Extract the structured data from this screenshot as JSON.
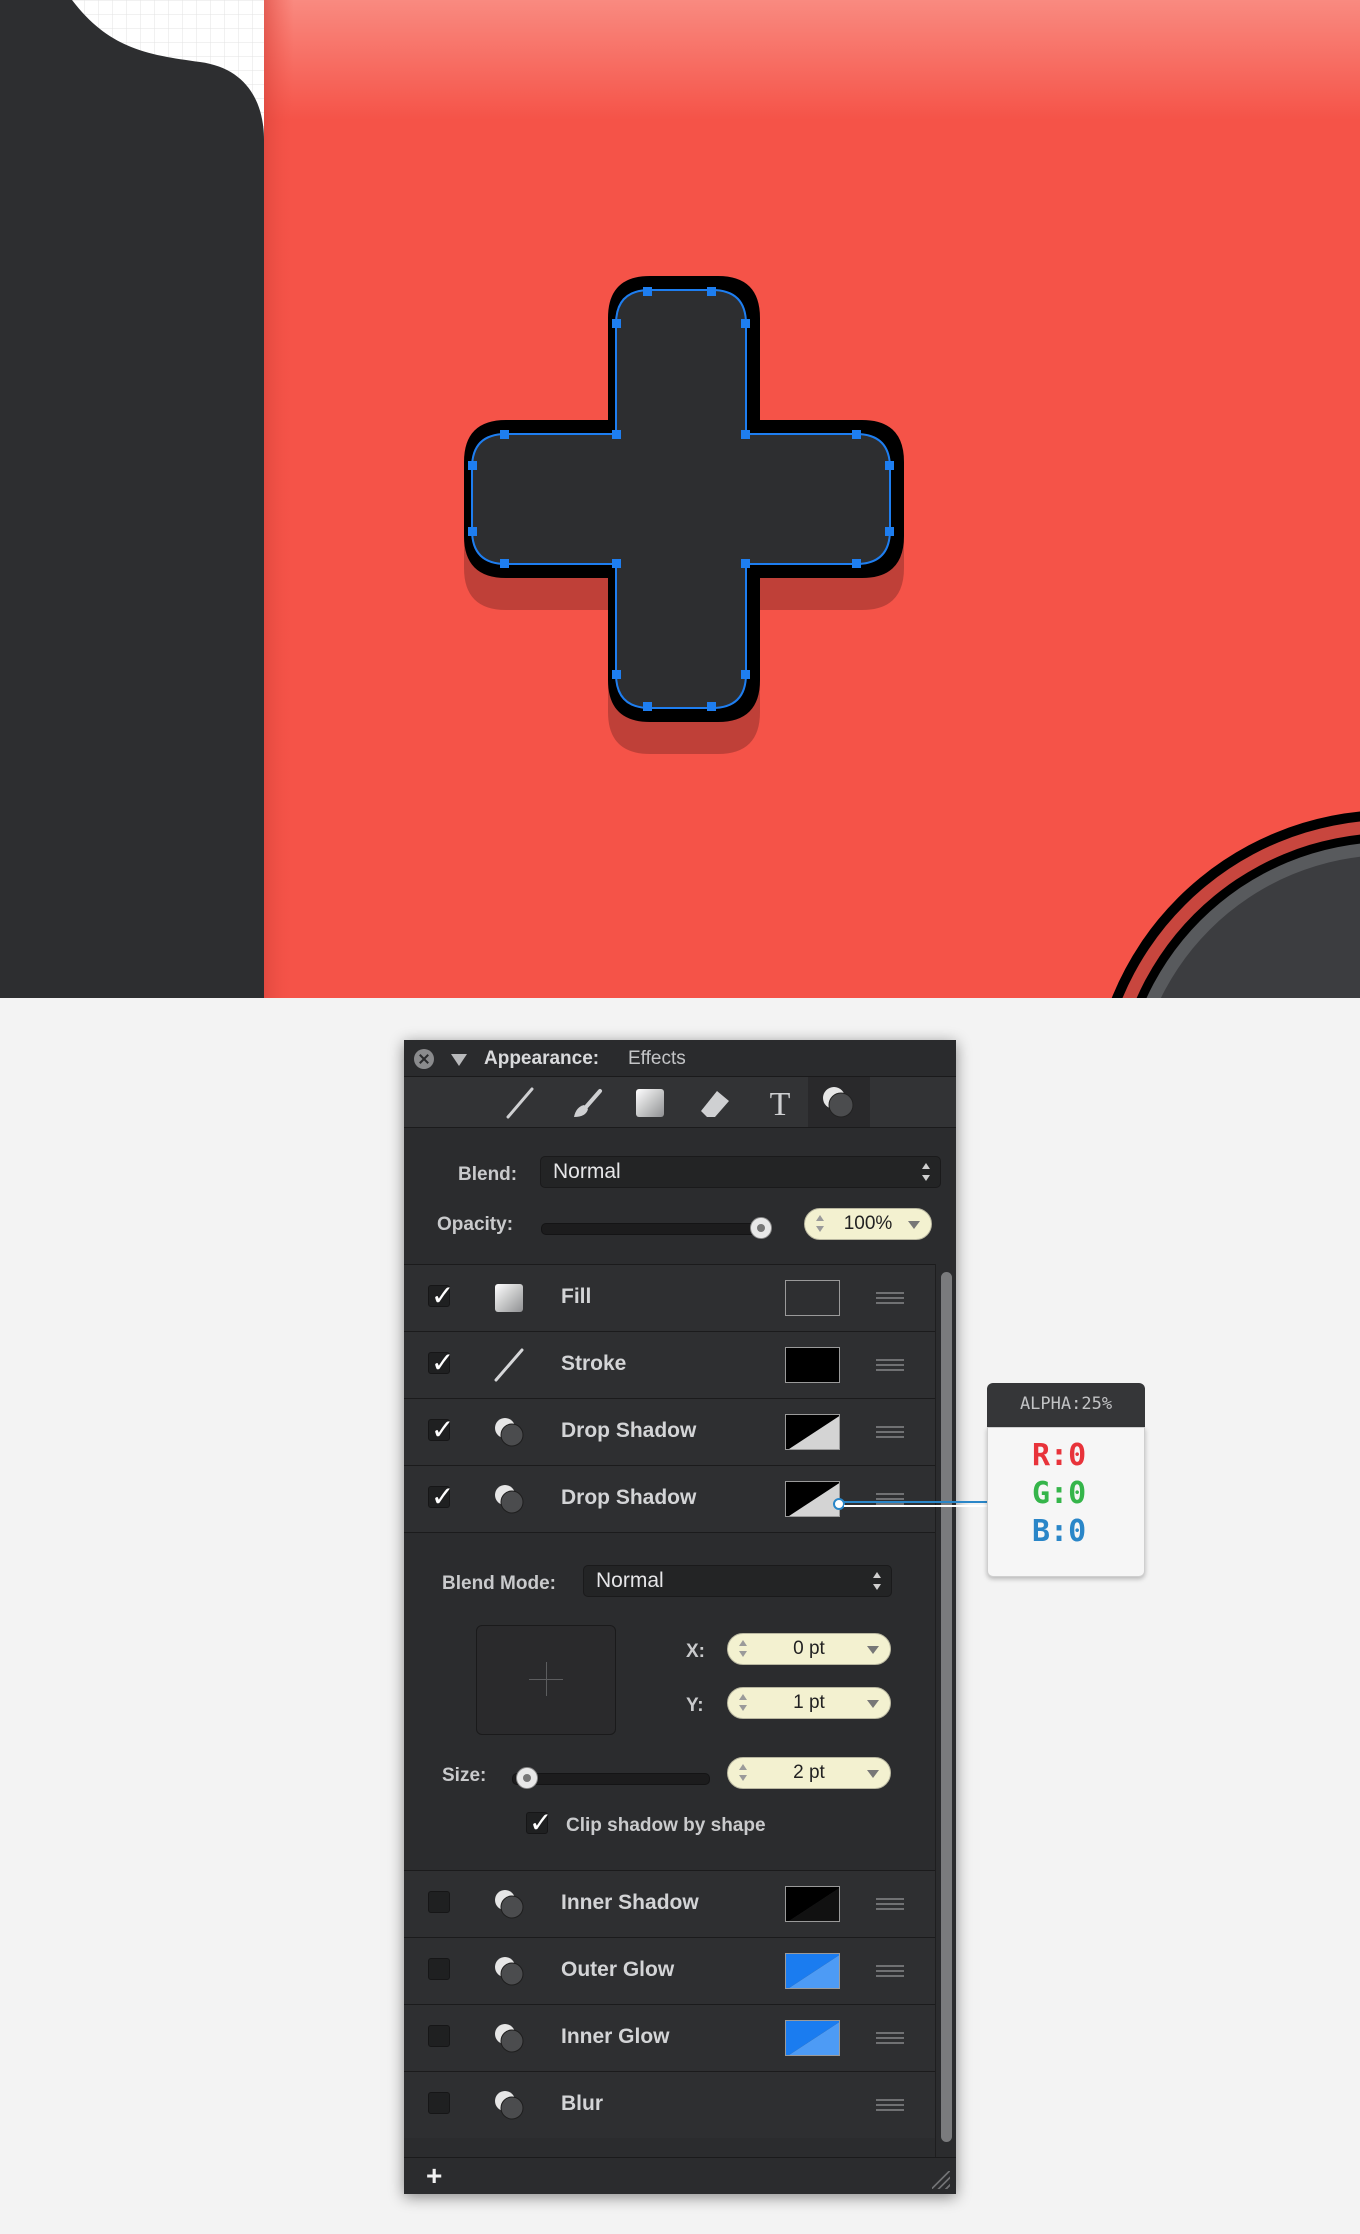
{
  "panel": {
    "title": "Appearance:",
    "subtitle": "Effects",
    "tools": [
      "stroke-tool",
      "brush-tool",
      "fill-tool",
      "eraser-tool",
      "text-tool",
      "effects-tool"
    ],
    "tool_text_glyph": "T",
    "blend_label": "Blend:",
    "blend_value": "Normal",
    "opacity_label": "Opacity:",
    "opacity_value": "100%",
    "opacity_fraction": 1.0,
    "effects": [
      {
        "name": "Fill",
        "enabled": true,
        "icon": "fill-square-icon",
        "swatch": "#2e2f31"
      },
      {
        "name": "Stroke",
        "enabled": true,
        "icon": "stroke-line-icon",
        "swatch": "#000000"
      },
      {
        "name": "Drop Shadow",
        "enabled": true,
        "icon": "shadow-icon",
        "swatch": "black-white"
      },
      {
        "name": "Drop Shadow",
        "enabled": true,
        "icon": "shadow-icon",
        "swatch": "black-white",
        "expanded": true
      }
    ],
    "detail": {
      "blend_mode_label": "Blend Mode:",
      "blend_mode_value": "Normal",
      "x_label": "X:",
      "x_value": "0 pt",
      "y_label": "Y:",
      "y_value": "1 pt",
      "size_label": "Size:",
      "size_value": "2 pt",
      "size_fraction": 0.0,
      "clip_label": "Clip shadow by shape",
      "clip_checked": true
    },
    "more_effects": [
      {
        "name": "Inner Shadow",
        "enabled": false,
        "swatch": "black"
      },
      {
        "name": "Outer Glow",
        "enabled": false,
        "swatch": "blue"
      },
      {
        "name": "Inner Glow",
        "enabled": false,
        "swatch": "blue"
      },
      {
        "name": "Blur",
        "enabled": false,
        "swatch": ""
      }
    ],
    "add_label": "+",
    "check_glyph": "✓"
  },
  "tooltip": {
    "header": "ALPHA:25%",
    "r": "R:0",
    "g": "G:0",
    "b": "B:0",
    "r_color": "#e8333a",
    "g_color": "#35b54a",
    "b_color": "#2a86c8"
  },
  "colors": {
    "canvas_red": "#f55348",
    "dark_shape": "#2d2e30",
    "selection_blue": "#1e7ef0"
  }
}
